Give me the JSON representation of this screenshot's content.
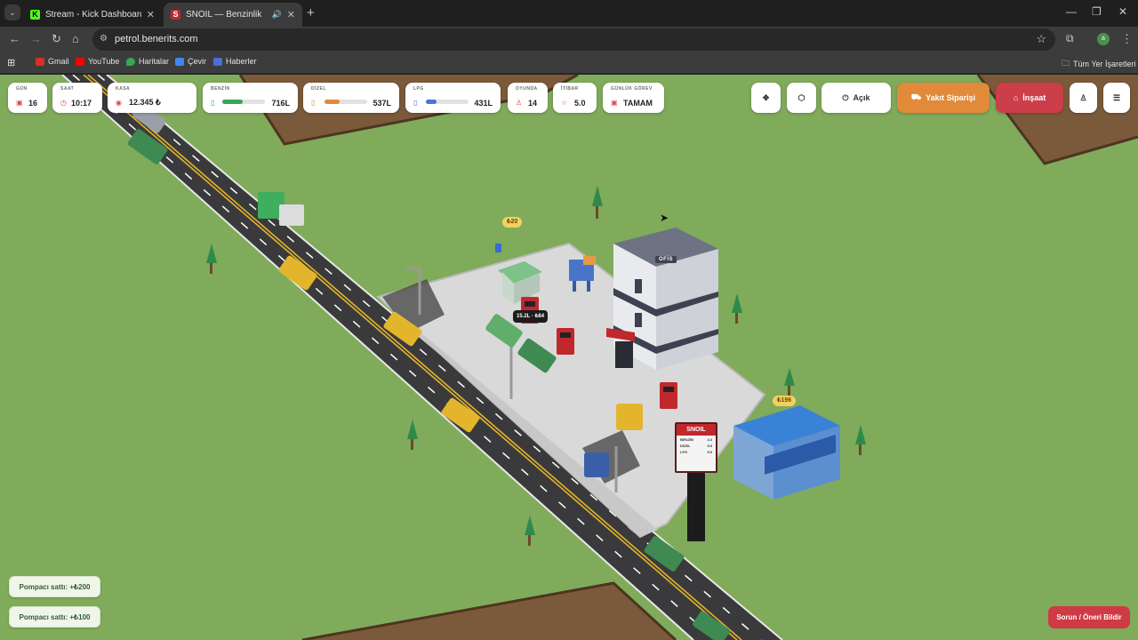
{
  "browser": {
    "tabs": [
      {
        "title": "Stream - Kick Dashboard",
        "favicon": "kick-icon",
        "active": false
      },
      {
        "title": "SNOIL — Benzinlik",
        "favicon": "snoil-icon",
        "active": true
      }
    ],
    "url": "petrol.benerits.com",
    "profile_initial": "a",
    "bookmarks": [
      {
        "label": "Gmail",
        "color": "#d93025"
      },
      {
        "label": "YouTube",
        "color": "#ff0000"
      },
      {
        "label": "Haritalar",
        "color": "#34a853"
      },
      {
        "label": "Çevir",
        "color": "#4285f4"
      },
      {
        "label": "Haberler",
        "color": "#4a6fd8"
      }
    ],
    "all_bookmarks_label": "Tüm Yer İşaretleri"
  },
  "hud": {
    "day": {
      "label": "GÜN",
      "value": "16"
    },
    "time": {
      "label": "SAAT",
      "value": "10:17"
    },
    "cash": {
      "label": "KASA",
      "value": "12.345 ₺"
    },
    "gasoline": {
      "label": "BENZİN",
      "value": "716L",
      "level": 0.48,
      "color": "#3aa655"
    },
    "diesel": {
      "label": "DİZEL",
      "value": "537L",
      "level": 0.36,
      "color": "#e08a3a"
    },
    "lpg": {
      "label": "LPG",
      "value": "431L",
      "level": 0.26,
      "color": "#4a72d8"
    },
    "players": {
      "label": "OYUNDA",
      "value": "14"
    },
    "reputation": {
      "label": "İTİBAR",
      "value": "5.0"
    },
    "daily_task": {
      "label": "GÜNLÜK GÖREV",
      "value": "TAMAM"
    }
  },
  "buttons": {
    "open": "Açık",
    "fuel_order": "Yakıt Siparişi",
    "build": "İnşaat",
    "report": "Sorun / Öneri Bildir"
  },
  "toasts": [
    "Pompacı sattı: +₺200",
    "Pompacı sattı: +₺100"
  ],
  "scene": {
    "coin_top": "₺20",
    "coin_right": "₺196",
    "pump_readout": "15.2L · ₺84",
    "office_label": "OFİS",
    "sign": {
      "brand": "SNOIL",
      "rows": [
        {
          "name": "BENZİN",
          "price": "4.4"
        },
        {
          "name": "DİZEL",
          "price": "5.5"
        },
        {
          "name": "LPG",
          "price": "5.0"
        }
      ]
    }
  }
}
